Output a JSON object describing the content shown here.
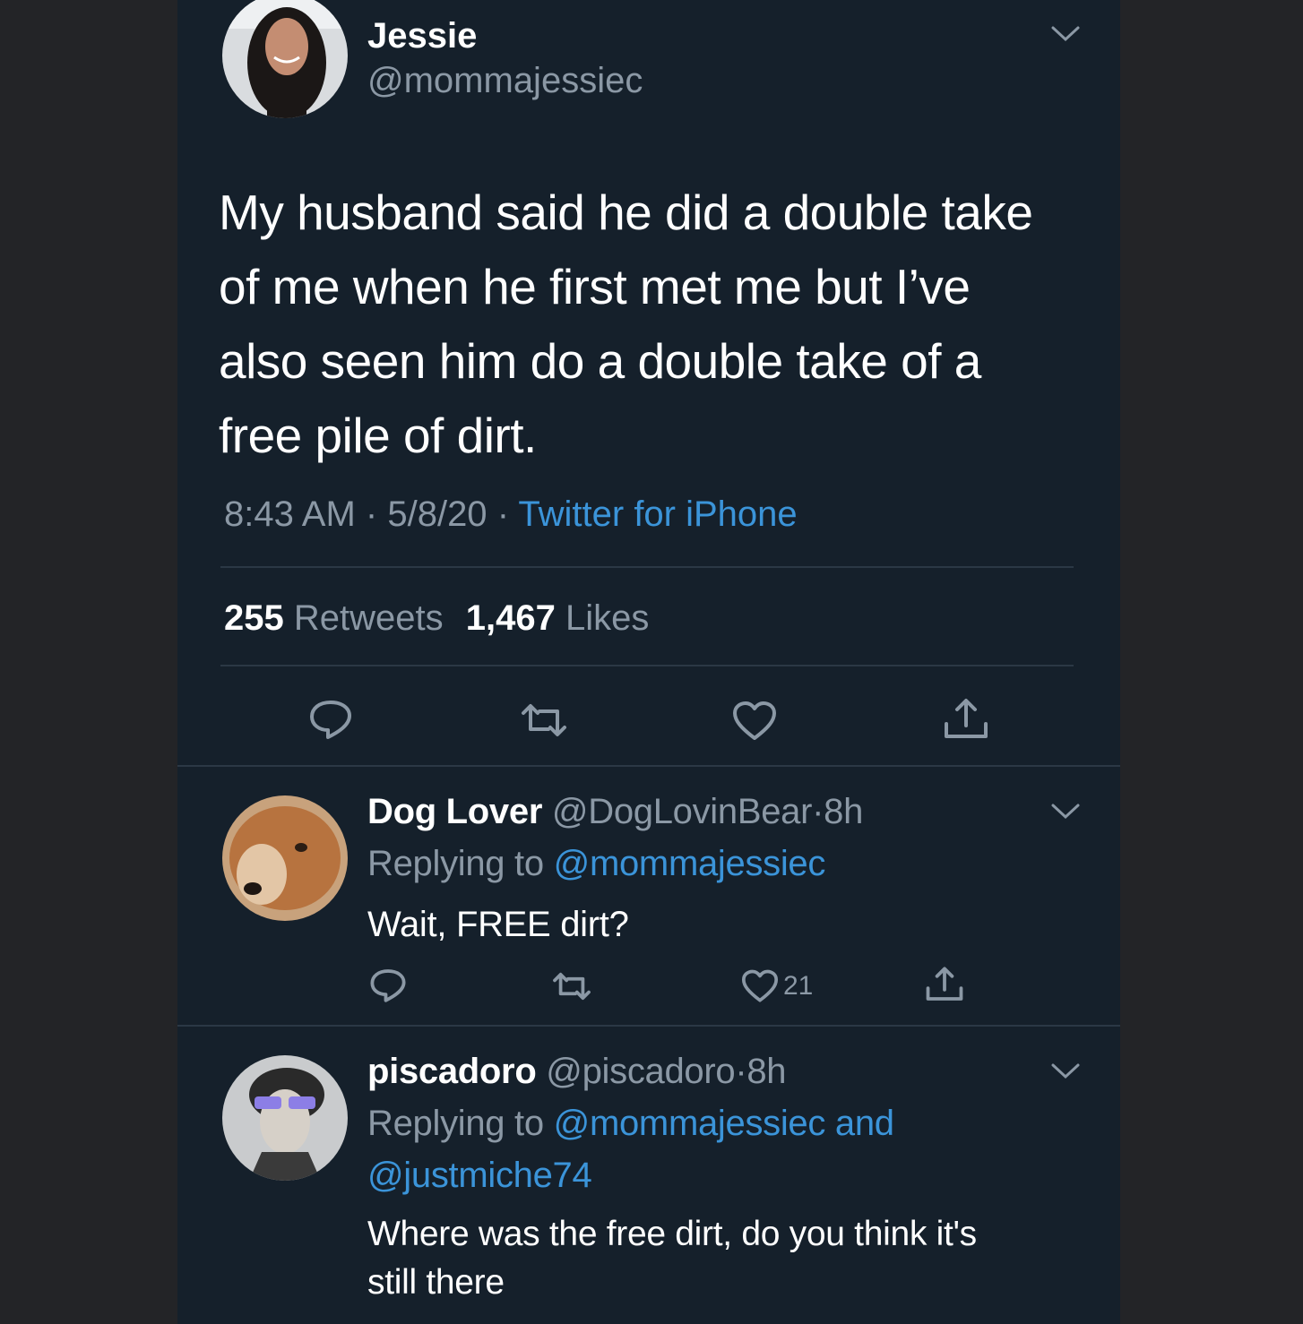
{
  "tweet": {
    "display_name": "Jessie",
    "handle": "@mommajessiec",
    "text_lines": [
      "My husband said he did a double take",
      "of me when he first met me but I’ve",
      "also seen him do a double take of a",
      "free pile of dirt."
    ],
    "time": "8:43 AM",
    "date": "5/8/20",
    "source": "Twitter for iPhone",
    "retweets_count": "255",
    "retweets_label": "Retweets",
    "likes_count": "1,467",
    "likes_label": "Likes",
    "sep": "·",
    "icons": [
      "reply-icon",
      "retweet-icon",
      "like-icon",
      "share-icon"
    ]
  },
  "replies": [
    {
      "display_name": "Dog Lover",
      "handle": "@DogLovinBear",
      "age": "8h",
      "replying_prefix": "Replying to",
      "replying_to": "@mommajessiec",
      "text": "Wait, FREE dirt?",
      "like_count": "21"
    },
    {
      "display_name": "piscadoro",
      "handle": "@piscadoro",
      "age": "8h",
      "replying_prefix": "Replying to",
      "replying_to_line1": "@mommajessiec and",
      "replying_to_line2": "@justmiche74",
      "text_line1": "Where was the free dirt, do you think it's",
      "text_line2": "still there"
    }
  ],
  "colors": {
    "page_bg": "#232427",
    "panel_bg": "#15202b",
    "text": "#e7e9ea",
    "muted": "#8b98a5",
    "link": "#3b94d9",
    "divider": "#2b3845"
  }
}
